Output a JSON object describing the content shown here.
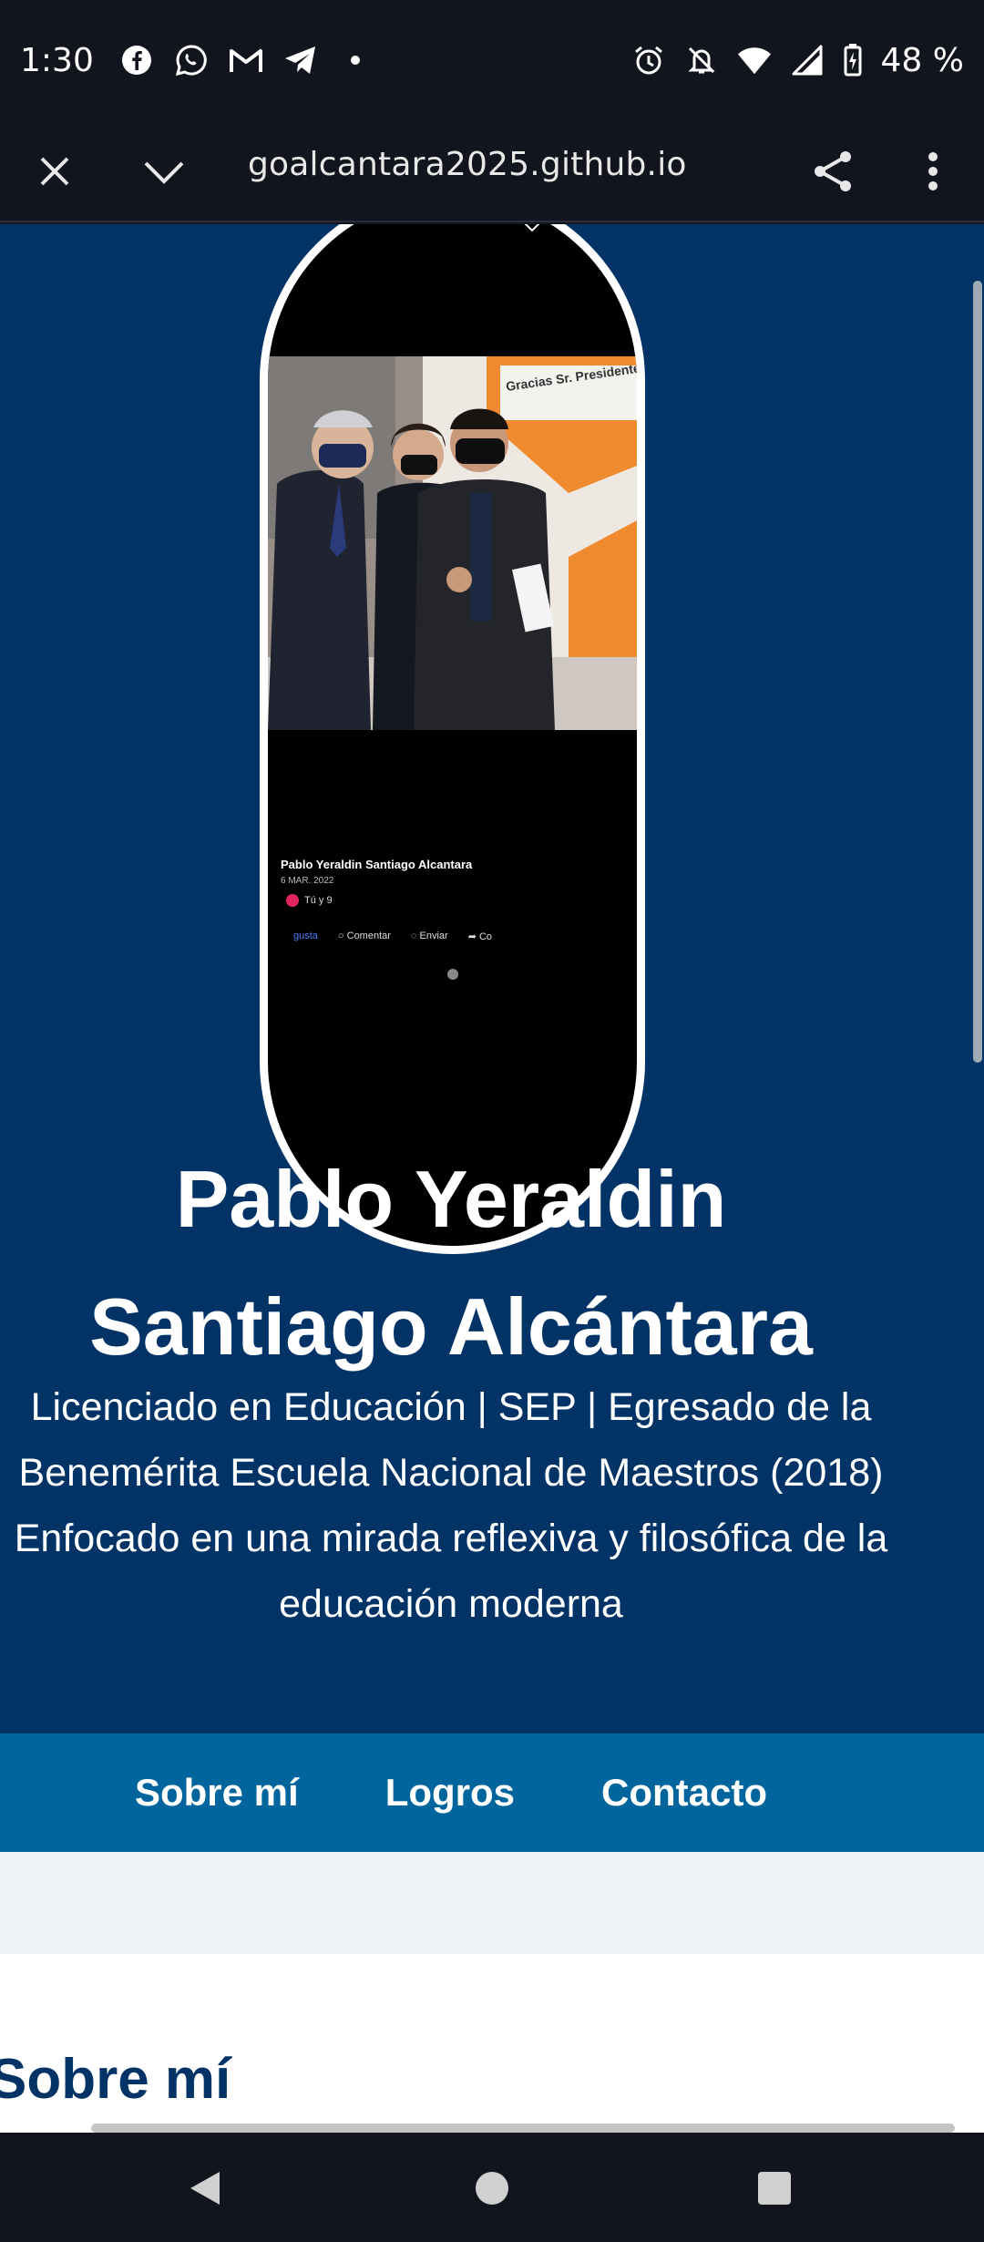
{
  "status_bar": {
    "time": "1:30",
    "battery": "48 %",
    "left_icons": [
      "facebook-icon",
      "whatsapp-icon",
      "gmail-icon",
      "telegram-icon",
      "dot-icon"
    ],
    "right_icons": [
      "alarm-icon",
      "bell-off-icon",
      "wifi-icon",
      "signal-icon",
      "battery-charging-icon"
    ]
  },
  "browser": {
    "url": "goalcantara2025.github.io"
  },
  "photo_post": {
    "author": "Pablo Yeraldin Santiago Alcantara",
    "date": "6 MAR. 2022",
    "likes": "Tú y 9",
    "actions": [
      "gusta",
      "Comentar",
      "Enviar",
      "Co"
    ],
    "banner_text": "Gracias Sr. Presidente"
  },
  "hero": {
    "name": "Pablo Yeraldin Santiago Alcántara",
    "description": "Licenciado en Educación | SEP | Egresado de la Benemérita Escuela Nacional de Maestros (2018) Enfocado en una mirada reflexiva y filosófica de la educación moderna"
  },
  "nav": {
    "items": [
      "Sobre mí",
      "Logros",
      "Contacto"
    ]
  },
  "section": {
    "title": "Sobre mí"
  },
  "colors": {
    "hero_bg": "#013366",
    "nav_bg": "#00659c",
    "status_bg": "#12151d"
  }
}
